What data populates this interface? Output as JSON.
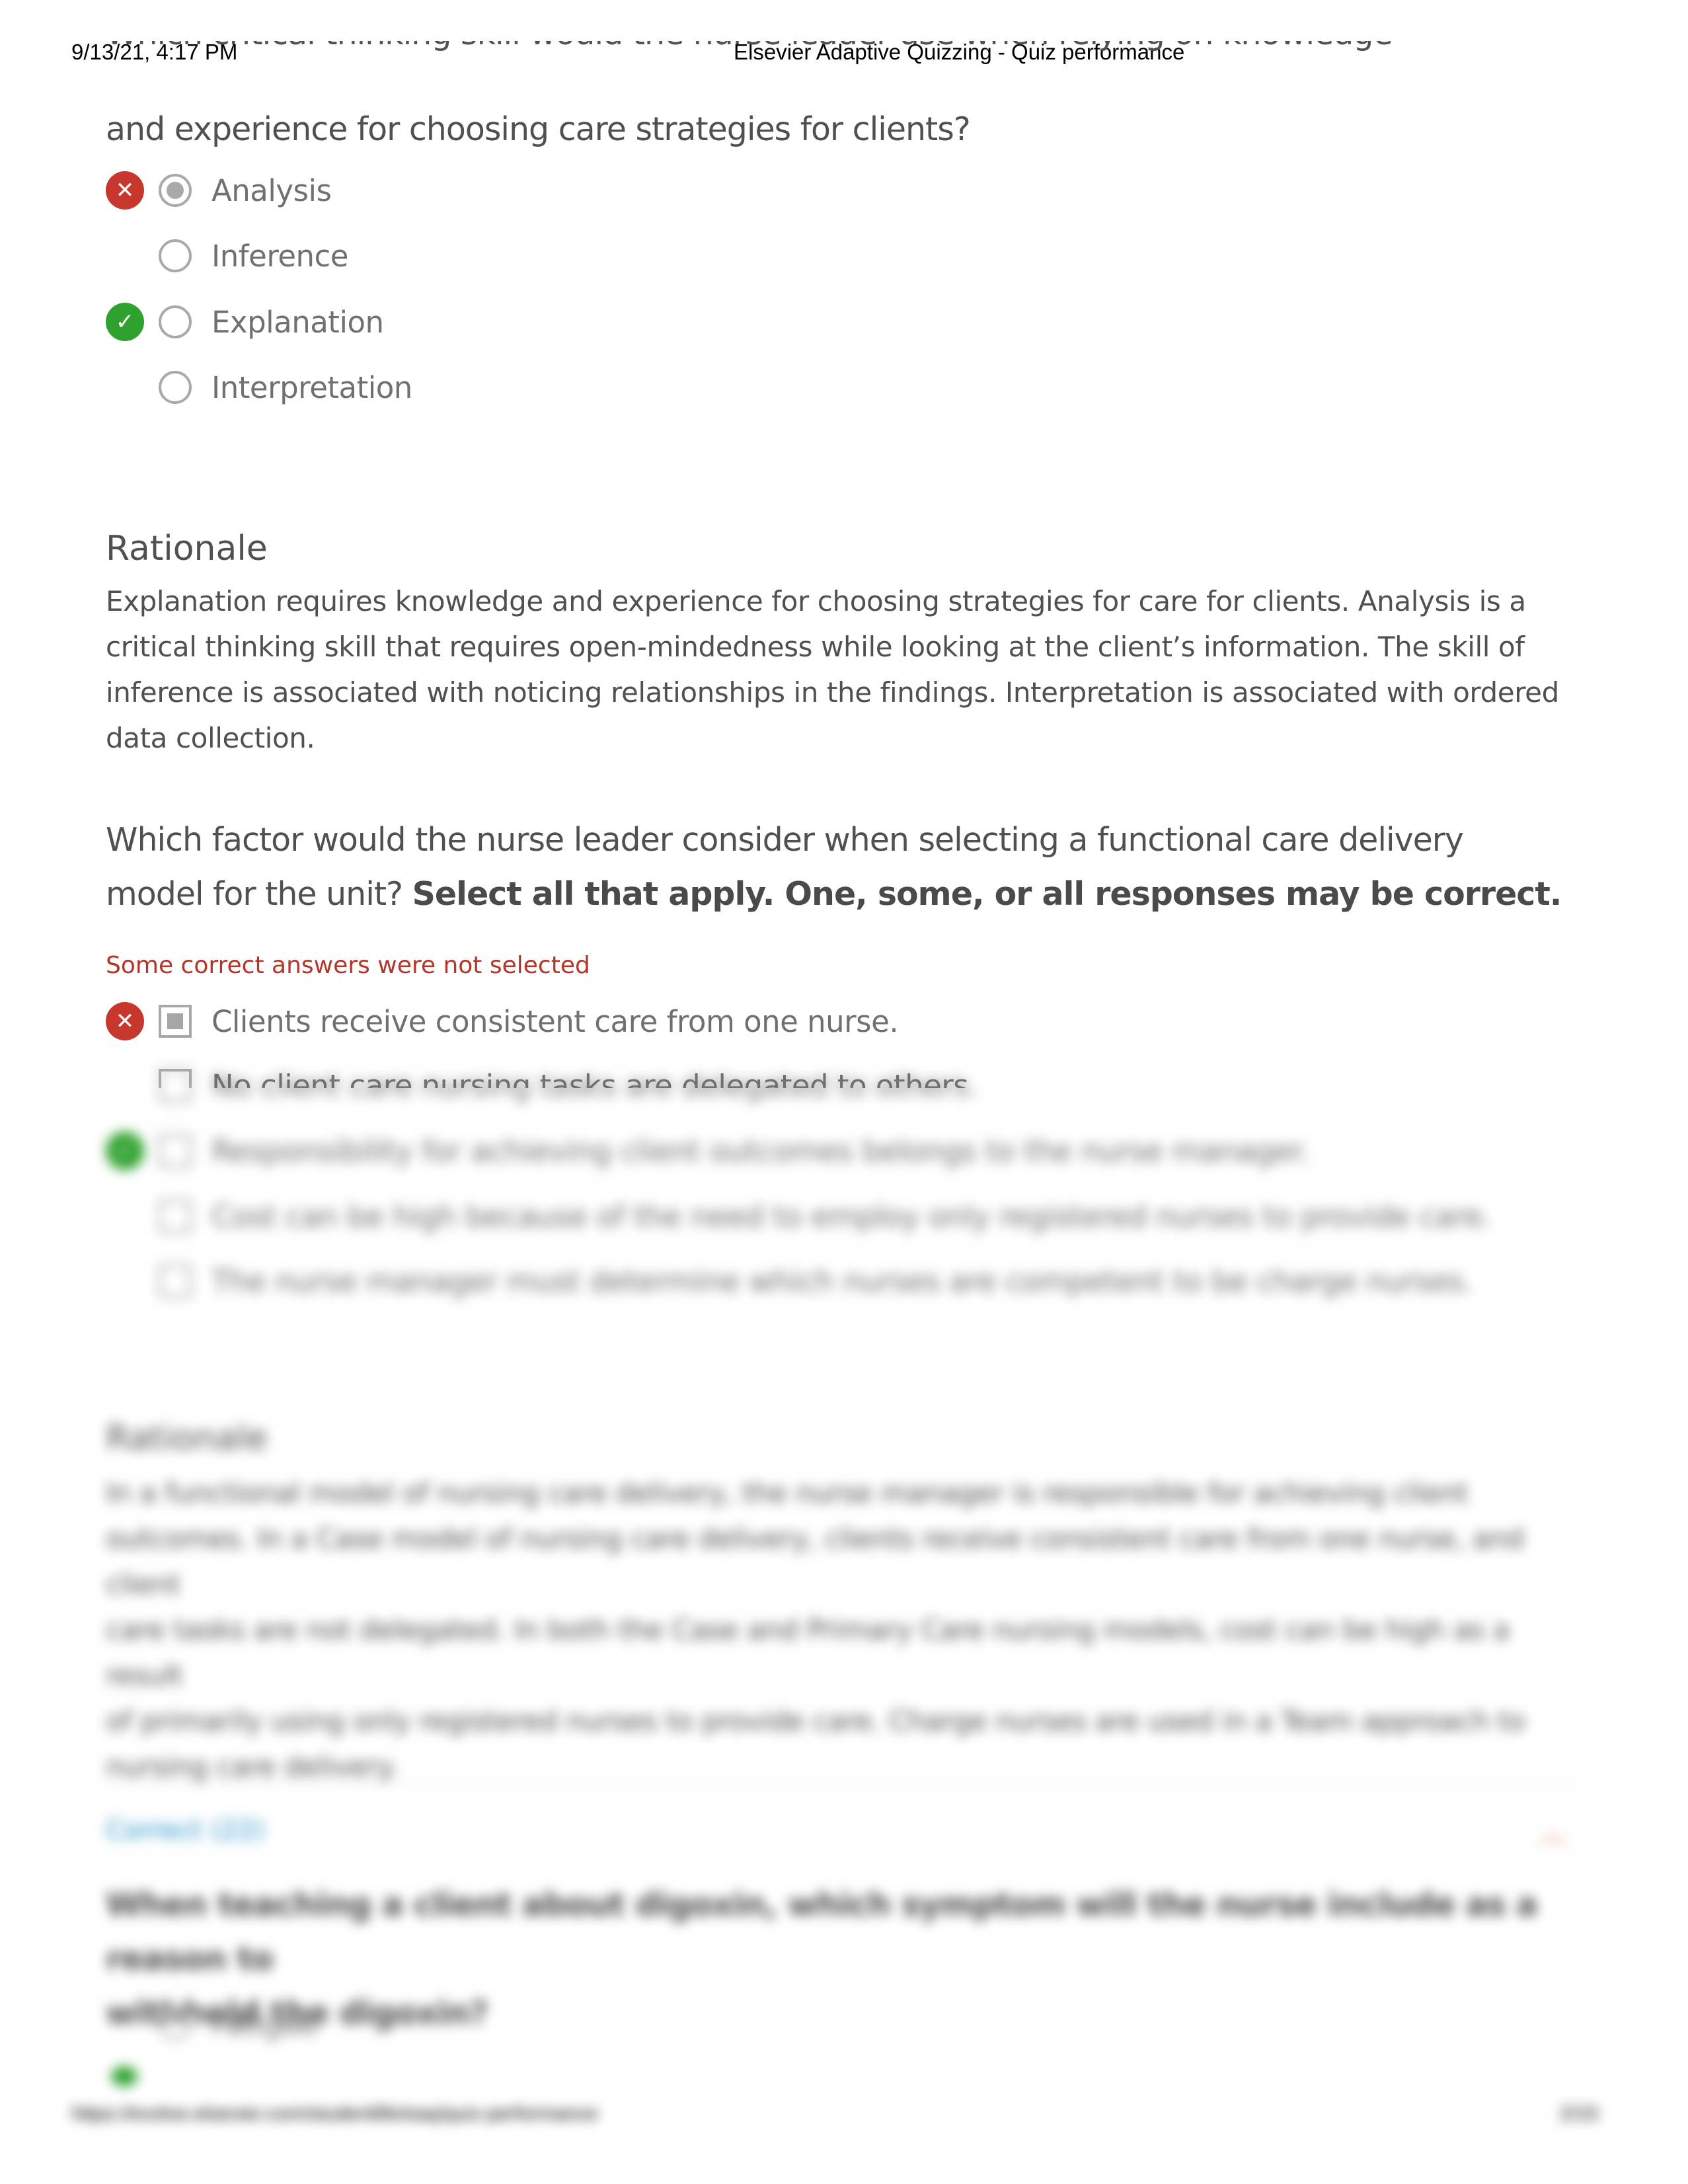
{
  "header": {
    "timestamp": "9/13/21, 4:17 PM",
    "title": "Elsevier Adaptive Quizzing - Quiz performance"
  },
  "colors": {
    "incorrect": "#c8372d",
    "correct": "#2ea12e",
    "feedback_text": "#b4352a",
    "accent_link": "#1a8fc4",
    "chevron": "#e6784a"
  },
  "question1": {
    "line1_partial": "Which critical thinking skill would the nurse leader use when relying on knowledge",
    "line2": "and experience for choosing care strategies for clients?",
    "options": [
      {
        "label": "Analysis",
        "selected": true,
        "status": "incorrect"
      },
      {
        "label": "Inference",
        "selected": false,
        "status": "none"
      },
      {
        "label": "Explanation",
        "selected": false,
        "status": "correct"
      },
      {
        "label": "Interpretation",
        "selected": false,
        "status": "none"
      }
    ],
    "rationale_heading": "Rationale",
    "rationale_lines": [
      "Explanation requires knowledge and experience for choosing strategies for care for clients. Analysis is a",
      "critical thinking skill that requires open-mindedness while looking at the client’s information. The skill of",
      "inference is associated with noticing relationships in the findings. Interpretation is associated with ordered",
      "data collection."
    ]
  },
  "question2": {
    "line1": "Which factor would the nurse leader consider when selecting a functional care delivery",
    "line2_plain": "model for the unit? ",
    "line2_bold": "Select all that apply.  One, some, or all responses may be correct.",
    "feedback": "Some correct answers were not selected",
    "options": [
      {
        "label": "Clients receive consistent care from one nurse.",
        "selected": true,
        "status": "incorrect"
      },
      {
        "label": "No client care nursing tasks are delegated to others.",
        "selected": false,
        "status": "none"
      },
      {
        "label": "Responsibility for achieving client outcomes belongs to the nurse manager.",
        "selected": false,
        "status": "correct"
      },
      {
        "label": "Cost can be high because of the need to employ only registered nurses to provide care.",
        "selected": false,
        "status": "none"
      },
      {
        "label": "The nurse manager must determine which nurses are competent to be charge nurses.",
        "selected": false,
        "status": "none"
      }
    ],
    "rationale_heading": "Rationale",
    "rationale_lines": [
      "In a functional model of nursing care delivery, the nurse manager is responsible for achieving client",
      "outcomes. In a Case model of nursing care delivery, clients receive consistent care from one nurse, and client",
      "care tasks are not delegated. In both the Case and Primary Care nursing models, cost can be high as a result",
      "of primarily using only registered nurses to provide care. Charge nurses are used in a Team approach to",
      "nursing care delivery."
    ]
  },
  "section": {
    "label": "Correct (22)",
    "toggle_icon": "chevron-up"
  },
  "question3": {
    "line1": "When teaching a client about digoxin, which symptom will the nurse include as a reason to",
    "line2": "withhold the digoxin?",
    "options": [
      {
        "label": "Fatigue",
        "selected": false,
        "status": "none"
      }
    ]
  },
  "footer": {
    "url": "https://evolve.elsevier.com/studentlife/eaq/quiz-performance",
    "page": "2/15"
  }
}
